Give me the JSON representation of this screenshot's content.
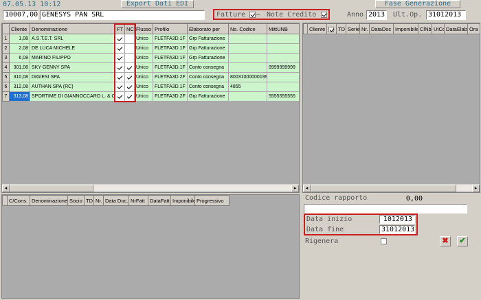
{
  "header": {
    "datetime": "07.05.13 10:12",
    "export_button": "Export Dati EDI",
    "phase_button": "Fase Generazione"
  },
  "filters": {
    "customer_code": "10007,00",
    "customer_name": "GENESYS PAN SRL",
    "fatture_label": "Fatture",
    "fatture_checked": true,
    "note_credito_label": "Note Credito",
    "note_credito_checked": true,
    "anno_label": "Anno",
    "anno_value": "2013",
    "ult_op_label": "Ult.Op.",
    "ult_op_value": "31012013"
  },
  "main_grid": {
    "columns": [
      "Cliente",
      "Denominazione",
      "FT",
      "NC",
      "Flusso",
      "Profilo",
      "Elaborato per",
      "Ns. Codice",
      "MittUNB"
    ],
    "rows": [
      {
        "n": "1",
        "cliente": "1,08",
        "denominazione": "A.S.T.E.T. SRL",
        "ft": true,
        "nc": false,
        "flusso": "Unico",
        "profilo": "FLETFA3D.1F",
        "elaborato": "Grp Fatturazione",
        "codice": "",
        "mitt": ""
      },
      {
        "n": "2",
        "cliente": "2,08",
        "denominazione": "DE LUCA MICHELE",
        "ft": true,
        "nc": false,
        "flusso": "Unico",
        "profilo": "FLETFA3D.1F",
        "elaborato": "Grp Fatturazione",
        "codice": "",
        "mitt": ""
      },
      {
        "n": "3",
        "cliente": "6,08",
        "denominazione": "MARINO FILIPPO",
        "ft": true,
        "nc": false,
        "flusso": "Unico",
        "profilo": "FLETFA3D.1F",
        "elaborato": "Grp Fatturazione",
        "codice": "",
        "mitt": ""
      },
      {
        "n": "4",
        "cliente": "301,08",
        "denominazione": "SKY GENNY SPA",
        "ft": true,
        "nc": true,
        "flusso": "Unico",
        "profilo": "FLETFA3D.1F",
        "elaborato": "Conto consegna",
        "codice": "",
        "mitt": "9999999999"
      },
      {
        "n": "5",
        "cliente": "310,08",
        "denominazione": "DIGIESI SPA",
        "ft": true,
        "nc": true,
        "flusso": "Unico",
        "profilo": "FLETFA3D.2F",
        "elaborato": "Conto consegna",
        "codice": "80031000000199",
        "mitt": ""
      },
      {
        "n": "6",
        "cliente": "312,08",
        "denominazione": "AUTHAN SPA (RC)",
        "ft": true,
        "nc": true,
        "flusso": "Unico",
        "profilo": "FLETFA3D.1F",
        "elaborato": "Conto consegna",
        "codice": "4855",
        "mitt": ""
      },
      {
        "n": "7",
        "cliente": "313,08",
        "denominazione": "SPORTIME DI GIANNOCCARO L. & C.",
        "ft": true,
        "nc": true,
        "flusso": "Unico",
        "profilo": "FLETFA3D.2F",
        "elaborato": "Grp Fatturazione",
        "codice": "",
        "mitt": "5555555555"
      }
    ]
  },
  "right_grid": {
    "columns": [
      "Cliente",
      "",
      "TD",
      "Serie",
      "Nr.",
      "DataDoc",
      "Imponibile",
      "ClNb",
      "UtCd",
      "DataElab",
      "Ora"
    ]
  },
  "bottom_grid": {
    "columns": [
      "C/Cons.",
      "Denominazione",
      "Socio",
      "TD",
      "Nr.",
      "Data Doc.",
      "NrFatt",
      "DataFatt",
      "Imponibile",
      "Progressivo"
    ]
  },
  "form": {
    "codice_rapporto_label": "Codice rapporto",
    "codice_rapporto_value": "0,00",
    "note_value": "",
    "data_inizio_label": "Data  inizio",
    "data_inizio_value": "1012013",
    "data_fine_label": "Data  fine",
    "data_fine_value": "31012013",
    "rigenera_label": "Rigenera",
    "rigenera_checked": false
  },
  "icons": {
    "cancel": "close-icon",
    "confirm": "check-icon",
    "cancel_color": "#c81e1e",
    "confirm_color": "#1c8c1c"
  }
}
